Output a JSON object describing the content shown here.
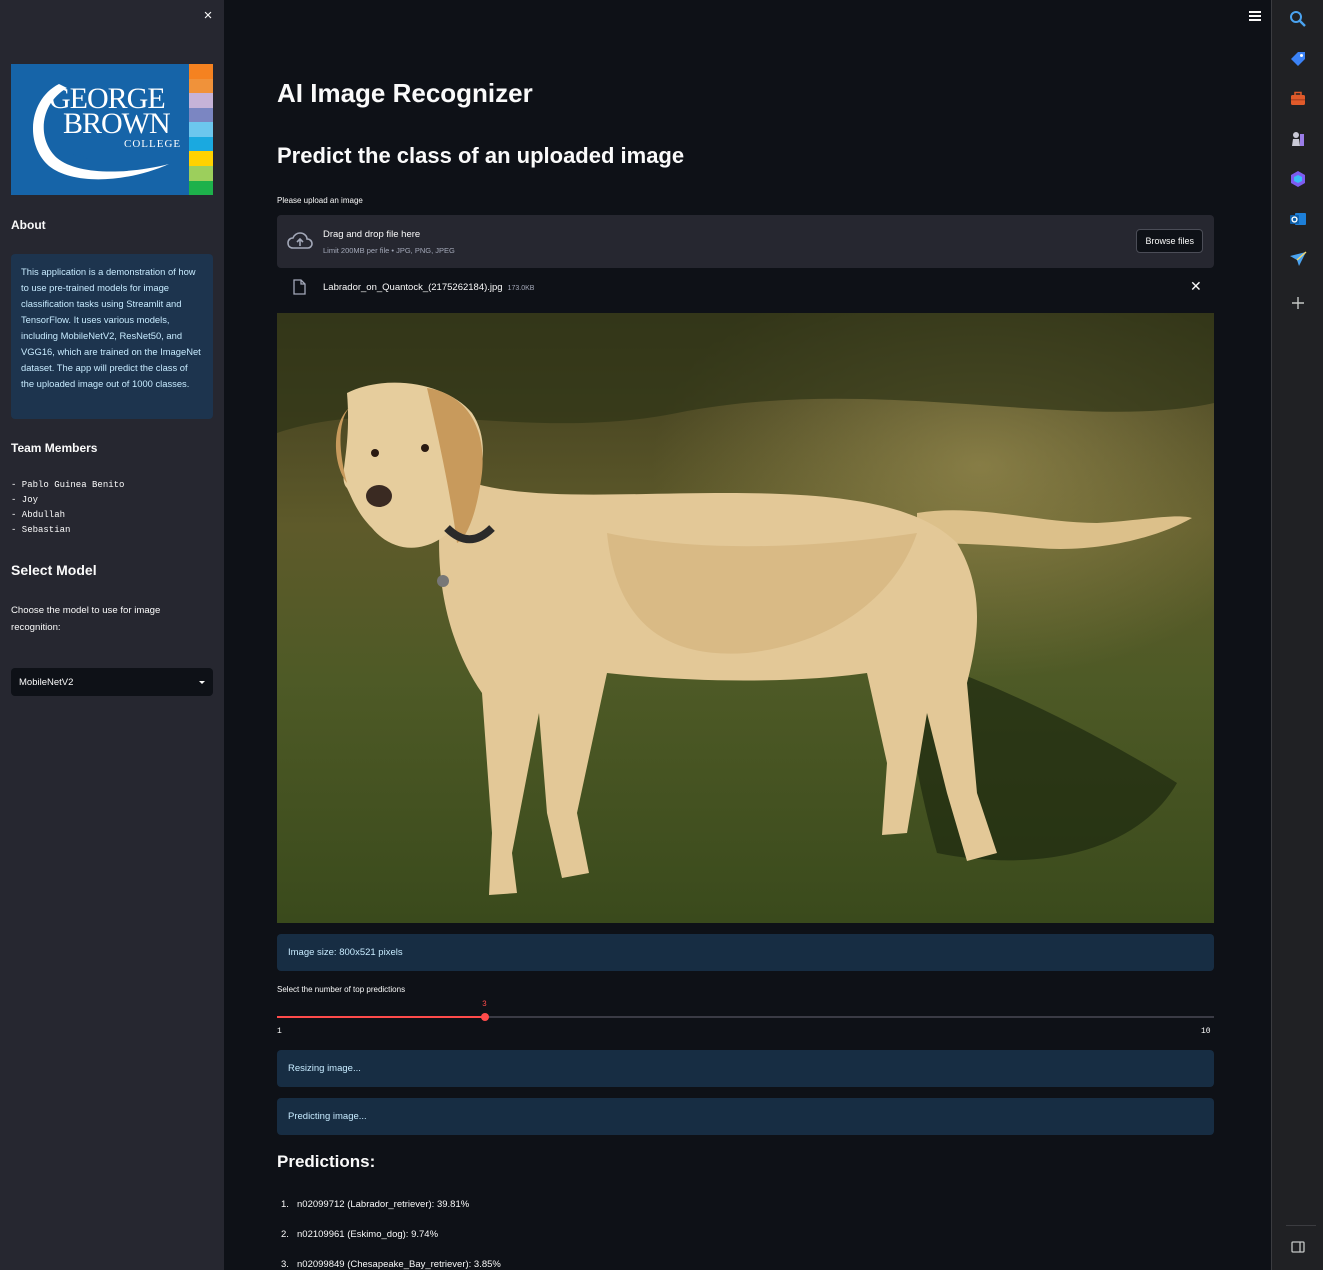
{
  "sidebar": {
    "close_label": "×",
    "logo": {
      "line1": "GEORGE",
      "line2": "BROWN",
      "line3": "COLLEGE",
      "stripe_colors": [
        "#f58220",
        "#f0923a",
        "#c6b3d8",
        "#7b86c2",
        "#6cc7ee",
        "#1aa9e0",
        "#ffd200",
        "#9ccf5c",
        "#1db14b"
      ]
    },
    "about_heading": "About",
    "about_text": "This application is a demonstration of how to use pre-trained models for image classification tasks using Streamlit and TensorFlow. It uses various models, including MobileNetV2, ResNet50, and VGG16, which are trained on the ImageNet dataset. The app will predict the class of the uploaded image out of 1000 classes.",
    "team_heading": "Team Members",
    "members": [
      "- Pablo Guinea Benito",
      "- Joy",
      "- Abdullah",
      "- Sebastian"
    ],
    "model_heading": "Select Model",
    "model_label": "Choose the model to use for image recognition:",
    "model_selected": "MobileNetV2"
  },
  "main": {
    "title": "AI Image Recognizer",
    "subtitle": "Predict the class of an uploaded image",
    "upload_label": "Please upload an image",
    "dropzone_main": "Drag and drop file here",
    "dropzone_sub": "Limit 200MB per file • JPG, PNG, JPEG",
    "browse_label": "Browse files",
    "file_name": "Labrador_on_Quantock_(2175262184).jpg",
    "file_size": "173.0KB",
    "image_size_text": "Image size: 800x521 pixels",
    "slider_label": "Select the number of top predictions",
    "slider_value": "3",
    "slider_min": "1",
    "slider_max": "10",
    "slider_fraction": 0.2222,
    "status_resizing": "Resizing image...",
    "status_predicting": "Predicting image...",
    "predictions_heading": "Predictions:",
    "predictions": [
      {
        "num": "1.",
        "text": "n02099712 (Labrador_retriever): 39.81%"
      },
      {
        "num": "2.",
        "text": "n02109961 (Eskimo_dog): 9.74%"
      },
      {
        "num": "3.",
        "text": "n02099849 (Chesapeake_Bay_retriever): 3.85%"
      }
    ]
  },
  "colors": {
    "background": "#0e1117",
    "sidebar": "#262730",
    "accent": "#ff4b4b",
    "info_bg": "#172d43",
    "info_text": "#c7ebff"
  },
  "toolbar_icons": [
    "search-icon",
    "tag-icon",
    "briefcase-icon",
    "chess-icon",
    "copilot-icon",
    "outlook-icon",
    "send-icon",
    "add-icon",
    "sidebar-toggle-icon"
  ]
}
